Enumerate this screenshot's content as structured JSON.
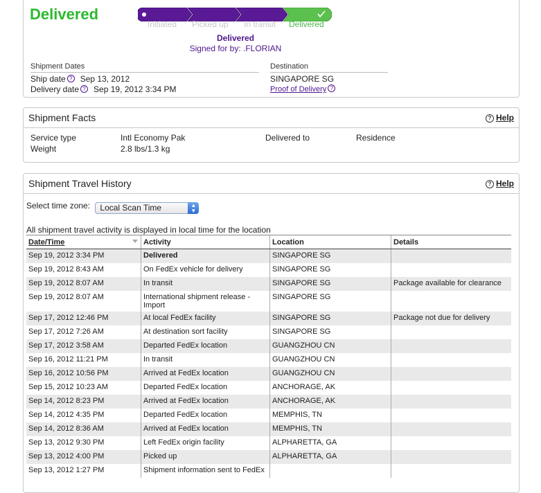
{
  "status": {
    "title": "Delivered",
    "steps": [
      {
        "label": "Initiated",
        "active": false
      },
      {
        "label": "Picked up",
        "active": false
      },
      {
        "label": "In transit",
        "active": false
      },
      {
        "label": "Delivered",
        "active": true
      }
    ],
    "detail_line1": "Delivered",
    "detail_line2": "Signed for by: .FLORIAN"
  },
  "dates": {
    "header": "Shipment Dates",
    "ship_label": "Ship date",
    "ship_value": "Sep 13, 2012",
    "delivery_label": "Delivery date",
    "delivery_value": "Sep 19, 2012 3:34 PM"
  },
  "destination": {
    "header": "Destination",
    "value": "SINGAPORE SG",
    "pod_link": "Proof of Delivery"
  },
  "facts": {
    "title": "Shipment Facts",
    "help": "Help",
    "service_label": "Service type",
    "service_value": "Intl Economy Pak",
    "weight_label": "Weight",
    "weight_value": "2.8 lbs/1.3 kg",
    "delivered_to_label": "Delivered to",
    "delivered_to_value": "Residence"
  },
  "history": {
    "title": "Shipment Travel History",
    "help": "Help",
    "tz_label": "Select time zone:",
    "tz_value": "Local Scan Time",
    "note": "All shipment travel activity is displayed in local time for the location",
    "columns": [
      "Date/Time",
      "Activity",
      "Location",
      "Details"
    ],
    "rows": [
      {
        "date": "Sep 19, 2012 3:34 PM",
        "activity": "Delivered",
        "location": "SINGAPORE SG",
        "details": ""
      },
      {
        "date": "Sep 19, 2012 8:43 AM",
        "activity": "On FedEx vehicle for delivery",
        "location": "SINGAPORE SG",
        "details": ""
      },
      {
        "date": "Sep 19, 2012 8:07 AM",
        "activity": "In transit",
        "location": "SINGAPORE SG",
        "details": "Package available for clearance"
      },
      {
        "date": "Sep 19, 2012 8:07 AM",
        "activity": "International shipment release - Import",
        "location": "SINGAPORE SG",
        "details": ""
      },
      {
        "date": "Sep 17, 2012 12:46 PM",
        "activity": "At local FedEx facility",
        "location": "SINGAPORE SG",
        "details": "Package not due for delivery"
      },
      {
        "date": "Sep 17, 2012 7:26 AM",
        "activity": "At destination sort facility",
        "location": "SINGAPORE SG",
        "details": ""
      },
      {
        "date": "Sep 17, 2012 3:58 AM",
        "activity": "Departed FedEx location",
        "location": "GUANGZHOU CN",
        "details": ""
      },
      {
        "date": "Sep 16, 2012 11:21 PM",
        "activity": "In transit",
        "location": "GUANGZHOU CN",
        "details": ""
      },
      {
        "date": "Sep 16, 2012 10:56 PM",
        "activity": "Arrived at FedEx location",
        "location": "GUANGZHOU CN",
        "details": ""
      },
      {
        "date": "Sep 15, 2012 10:23 AM",
        "activity": "Departed FedEx location",
        "location": "ANCHORAGE, AK",
        "details": ""
      },
      {
        "date": "Sep 14, 2012 8:23 PM",
        "activity": "Arrived at FedEx location",
        "location": "ANCHORAGE, AK",
        "details": ""
      },
      {
        "date": "Sep 14, 2012 4:35 PM",
        "activity": "Departed FedEx location",
        "location": "MEMPHIS, TN",
        "details": ""
      },
      {
        "date": "Sep 14, 2012 8:36 AM",
        "activity": "Arrived at FedEx location",
        "location": "MEMPHIS, TN",
        "details": ""
      },
      {
        "date": "Sep 13, 2012 9:30 PM",
        "activity": "Left FedEx origin facility",
        "location": "ALPHARETTA, GA",
        "details": ""
      },
      {
        "date": "Sep 13, 2012 4:00 PM",
        "activity": "Picked up",
        "location": "ALPHARETTA, GA",
        "details": ""
      },
      {
        "date": "Sep 13, 2012 1:27 PM",
        "activity": "Shipment information sent to FedEx",
        "location": "",
        "details": ""
      }
    ]
  },
  "colors": {
    "delivered_green": "#2eb82e",
    "fedex_purple": "#4d148c",
    "progress_green": "#4db848",
    "row_stripe": "#e9e9e9"
  }
}
